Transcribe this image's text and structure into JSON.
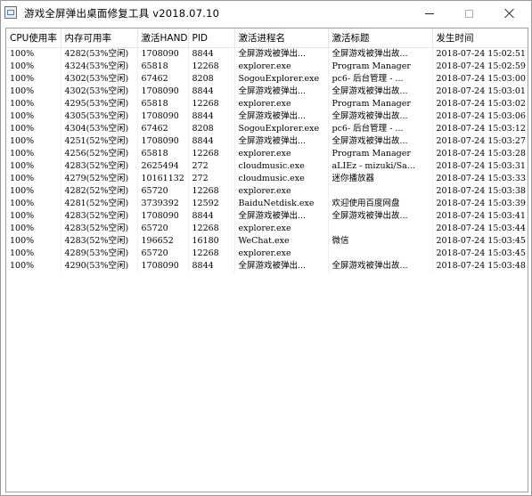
{
  "window": {
    "title": "游戏全屏弹出桌面修复工具    v2018.07.10"
  },
  "table": {
    "headers": [
      "CPU使用率",
      "内存可用率",
      "激活HAND",
      "PID",
      "激活进程名",
      "激活标题",
      "发生时间"
    ],
    "rows": [
      [
        "100%",
        "4282(53%空闲)",
        "1708090",
        "8844",
        "全屏游戏被弹出...",
        "全屏游戏被弹出故...",
        "2018-07-24 15:02:51"
      ],
      [
        "100%",
        "4324(53%空闲)",
        "65818",
        "12268",
        "explorer.exe",
        "Program Manager",
        "2018-07-24 15:02:59"
      ],
      [
        "100%",
        "4302(53%空闲)",
        "67462",
        "8208",
        "SogouExplorer.exe",
        "pc6- 后台管理 - ...",
        "2018-07-24 15:03:00"
      ],
      [
        "100%",
        "4302(53%空闲)",
        "1708090",
        "8844",
        "全屏游戏被弹出...",
        "全屏游戏被弹出故...",
        "2018-07-24 15:03:01"
      ],
      [
        "100%",
        "4295(53%空闲)",
        "65818",
        "12268",
        "explorer.exe",
        "Program Manager",
        "2018-07-24 15:03:02"
      ],
      [
        "100%",
        "4305(53%空闲)",
        "1708090",
        "8844",
        "全屏游戏被弹出...",
        "全屏游戏被弹出故...",
        "2018-07-24 15:03:06"
      ],
      [
        "100%",
        "4304(53%空闲)",
        "67462",
        "8208",
        "SogouExplorer.exe",
        "pc6- 后台管理 - ...",
        "2018-07-24 15:03:12"
      ],
      [
        "100%",
        "4251(52%空闲)",
        "1708090",
        "8844",
        "全屏游戏被弹出...",
        "全屏游戏被弹出故...",
        "2018-07-24 15:03:27"
      ],
      [
        "100%",
        "4256(52%空闲)",
        "65818",
        "12268",
        "explorer.exe",
        "Program Manager",
        "2018-07-24 15:03:28"
      ],
      [
        "100%",
        "4283(52%空闲)",
        "2625494",
        "272",
        "cloudmusic.exe",
        "aLIEz - mizuki/Sa...",
        "2018-07-24 15:03:31"
      ],
      [
        "100%",
        "4279(52%空闲)",
        "10161132",
        "272",
        "cloudmusic.exe",
        "迷你播放器",
        "2018-07-24 15:03:33"
      ],
      [
        "100%",
        "4282(52%空闲)",
        "65720",
        "12268",
        "explorer.exe",
        "",
        "2018-07-24 15:03:38"
      ],
      [
        "100%",
        "4281(52%空闲)",
        "3739392",
        "12592",
        "BaiduNetdisk.exe",
        "欢迎使用百度网盘",
        "2018-07-24 15:03:39"
      ],
      [
        "100%",
        "4283(52%空闲)",
        "1708090",
        "8844",
        "全屏游戏被弹出...",
        "全屏游戏被弹出故...",
        "2018-07-24 15:03:41"
      ],
      [
        "100%",
        "4283(52%空闲)",
        "65720",
        "12268",
        "explorer.exe",
        "",
        "2018-07-24 15:03:44"
      ],
      [
        "100%",
        "4283(52%空闲)",
        "196652",
        "16180",
        "WeChat.exe",
        "微信",
        "2018-07-24 15:03:45"
      ],
      [
        "100%",
        "4289(53%空闲)",
        "65720",
        "12268",
        "explorer.exe",
        "",
        "2018-07-24 15:03:45"
      ],
      [
        "100%",
        "4290(53%空闲)",
        "1708090",
        "8844",
        "全屏游戏被弹出...",
        "全屏游戏被弹出故...",
        "2018-07-24 15:03:48"
      ]
    ]
  },
  "icons": {
    "app": "app-window-icon",
    "minimize": "minimize-icon",
    "maximize": "maximize-icon",
    "close": "close-icon"
  }
}
